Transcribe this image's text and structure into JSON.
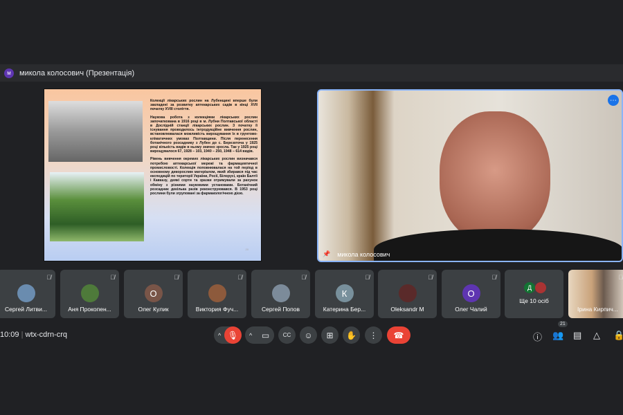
{
  "presenter": {
    "initial": "м",
    "label": "микола колосович (Презентація)"
  },
  "slide": {
    "paragraphs": [
      "Колекції лікарських рослин на Лубенщині вперше були закладені за розвитку аптекарських садів в кінці XVII початку XVIII століття.",
      "Наукова робота з колекціями лікарських рослин започаткована в 1916 році в м. Лубни Полтавської області в Дослідній станції лікарських рослин. З початку її існування проводилось інтродукційне вивчення рослин, встановлювалася можливість вирощування їх в грунтово-кліматичних умовах Полтавщини. Після перенесення ботанічного розсаднику з Лубен до с. Березоточа у 1925 році кількість видів в ньому значно зросла. Так у 1925 році вирощувалося 67, 1928 – 103, 1940 – 250, 1948 – 614 видів.",
      "Рівень вивчення окремих лікарських рослин визначався потребою аптекарської мережі та фармацевтичної промисловості. Колекція поповнювалася на той період в основному дикорослим матеріалом, який збирався під час експедицій по території України, Росії, Білорусі, країн Балтії і Кавказу, деякі сорти та зразки отримували за рахунок обміну з різними науковими установами. Ботанічний розсадник декілька разів реконструювався. В 1953 році рослини були згруповані за фармакологічною дією."
    ],
    "page": "20"
  },
  "speaker": {
    "name": "микола колосович",
    "more": "⋯"
  },
  "participants": [
    {
      "name": "Сергей Литви...",
      "initial": "",
      "color": "#6a8caf"
    },
    {
      "name": "Аня Прокопен...",
      "initial": "",
      "color": "#4e7a3a"
    },
    {
      "name": "Олег Кулик",
      "initial": "О",
      "color": "#795548"
    },
    {
      "name": "Виктория Фуч...",
      "initial": "",
      "color": "#8d5a3c"
    },
    {
      "name": "Сергей Попов",
      "initial": "",
      "color": "#7c8b9a"
    },
    {
      "name": "Катерина Бер...",
      "initial": "К",
      "color": "#78909c"
    },
    {
      "name": "Oleksandr M",
      "initial": "",
      "color": "#5a2a2a"
    },
    {
      "name": "Олег Чалий",
      "initial": "О",
      "color": "#5e35b1"
    }
  ],
  "more_tile": {
    "label": "Ще 10 осіб",
    "initial": "Д"
  },
  "self_tile": {
    "name": "Ірина Кирпич..."
  },
  "meeting": {
    "time": "10:09",
    "code": "wtx-cdrn-crq",
    "people_count": "21"
  },
  "colors": {
    "end_call": "#ea4335",
    "mic_off": "#ea4335",
    "accent": "#8ab4f8"
  }
}
